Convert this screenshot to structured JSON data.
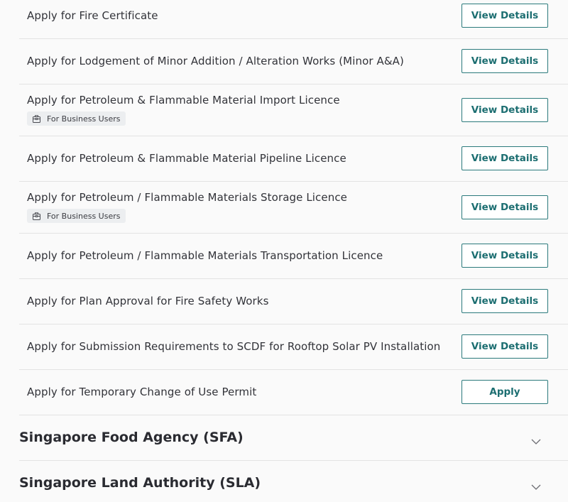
{
  "services": [
    {
      "title": "Apply for Fire Certificate",
      "action": "View Details"
    },
    {
      "title": "Apply for Lodgement of Minor Addition / Alteration Works (Minor A&A)",
      "action": "View Details"
    },
    {
      "title": "Apply for Petroleum & Flammable Material Import Licence",
      "badge": "For Business Users",
      "badge_icon": "briefcase-icon",
      "action": "View Details"
    },
    {
      "title": "Apply for Petroleum & Flammable Material Pipeline Licence",
      "action": "View Details"
    },
    {
      "title": "Apply for Petroleum / Flammable Materials Storage Licence",
      "badge": "For Business Users",
      "badge_icon": "briefcase-icon",
      "action": "View Details"
    },
    {
      "title": "Apply for Petroleum / Flammable Materials Transportation Licence",
      "action": "View Details"
    },
    {
      "title": "Apply for Plan Approval for Fire Safety Works",
      "action": "View Details"
    },
    {
      "title": "Apply for Submission Requirements to SCDF for Rooftop Solar PV Installation",
      "action": "View Details"
    },
    {
      "title": "Apply for Temporary Change of Use Permit",
      "action": "Apply"
    }
  ],
  "agencies": [
    {
      "title": "Singapore Food Agency (SFA)",
      "icon": "chevron-down-icon"
    },
    {
      "title": "Singapore Land Authority (SLA)",
      "icon": "chevron-down-icon"
    }
  ],
  "colors": {
    "accent": "#1c6e71",
    "border": "#2b7a7c",
    "background": "#fafafa",
    "divider": "#e3e3e3"
  }
}
